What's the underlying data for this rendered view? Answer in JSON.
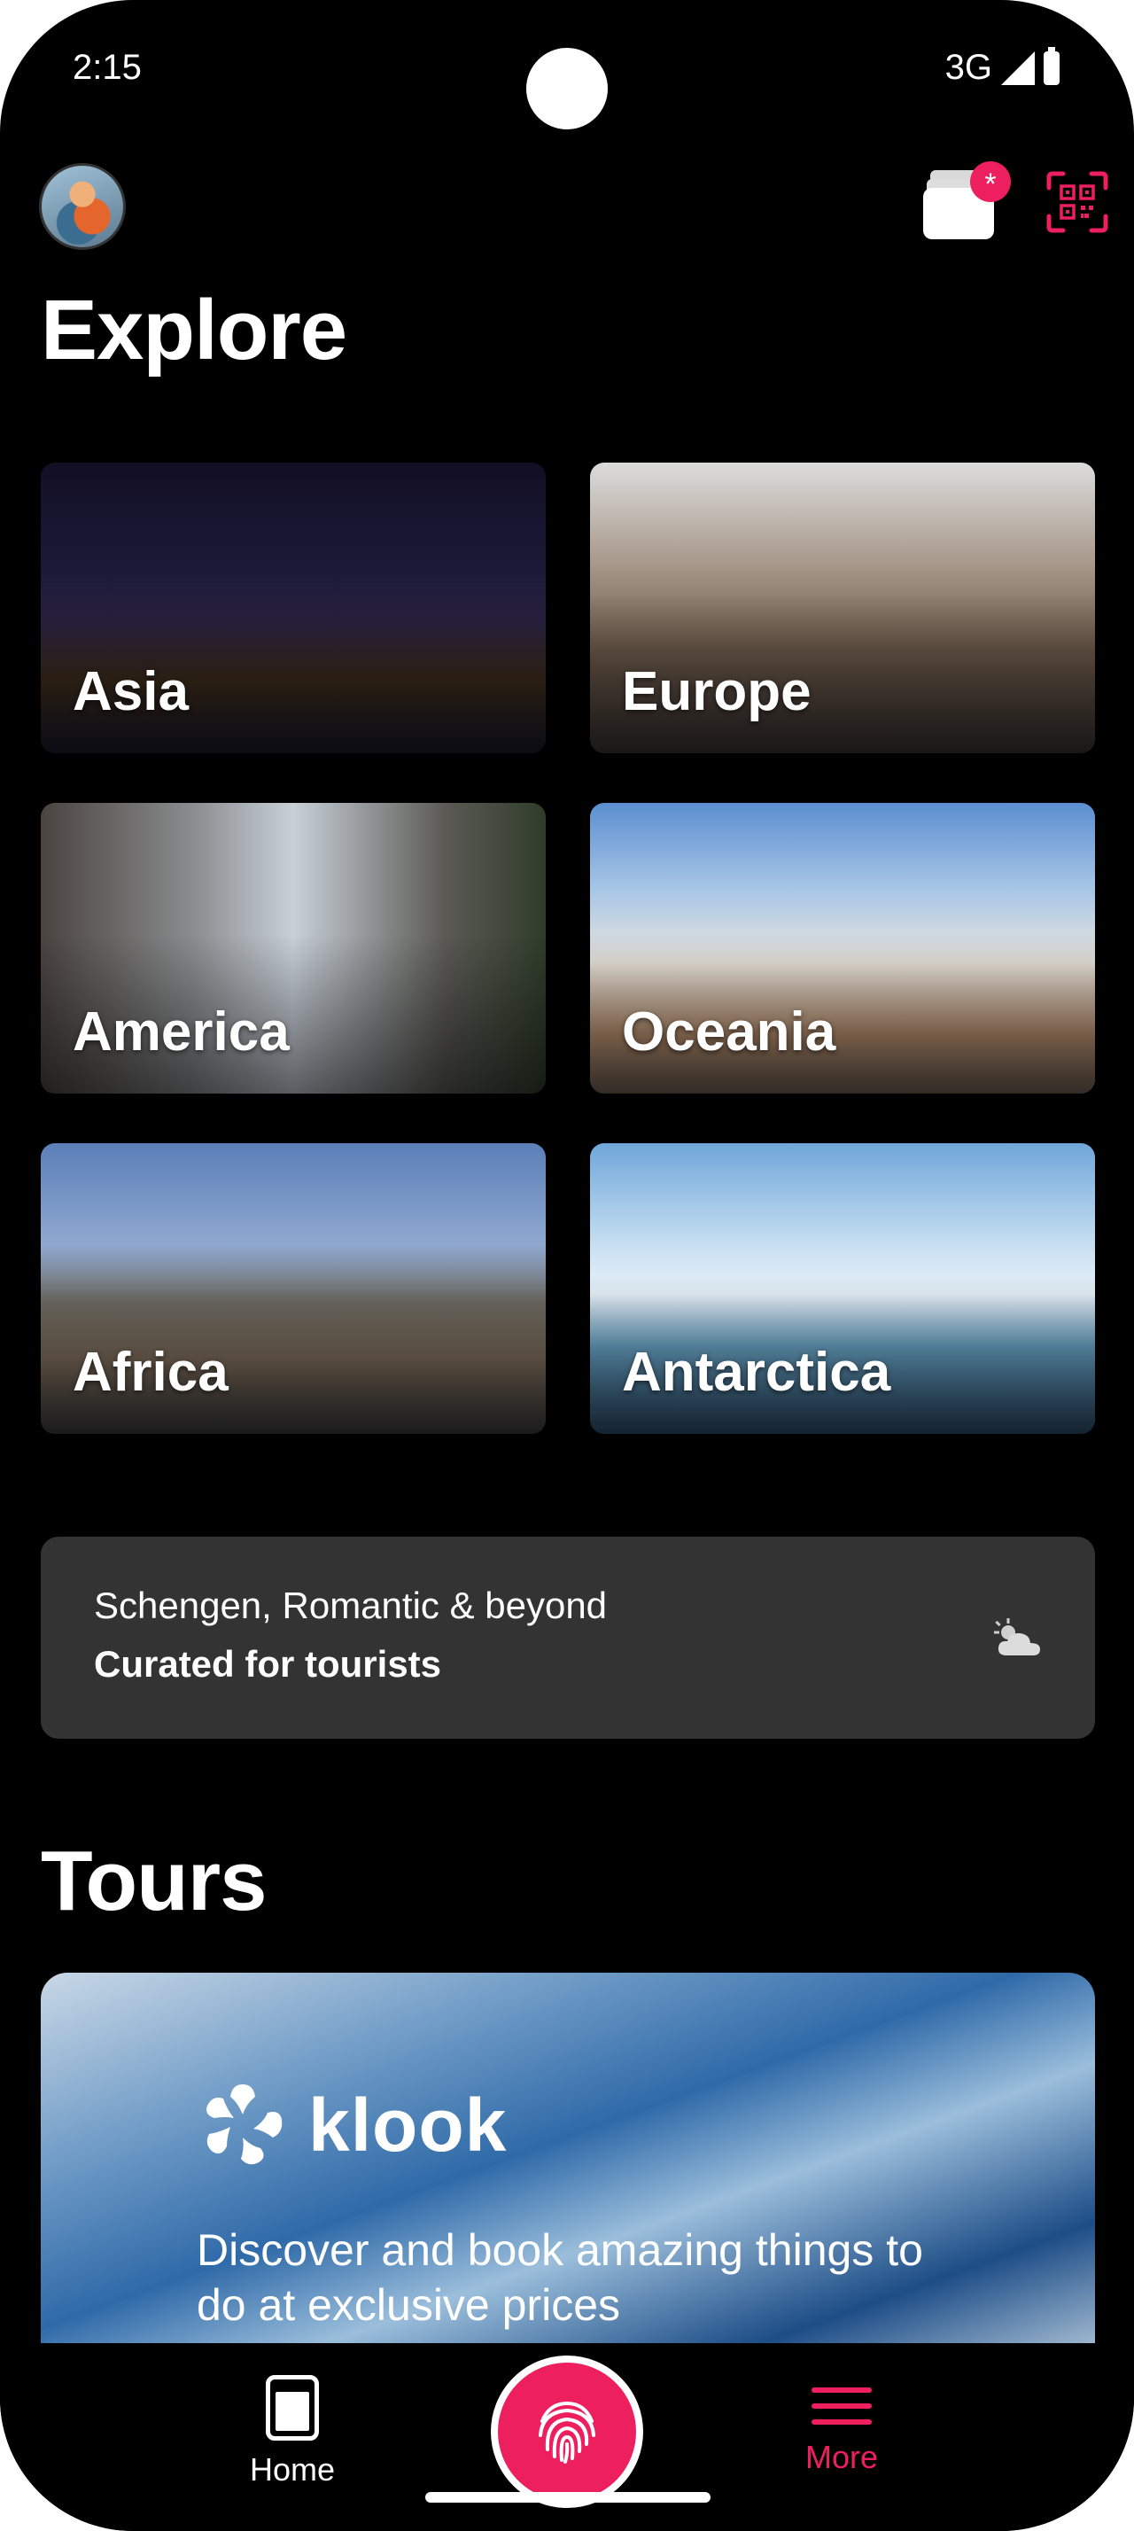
{
  "status_bar": {
    "time": "2:15",
    "network": "3G"
  },
  "header": {
    "avatar_icon": "avatar-photo",
    "wallet_icon": "wallet-icon",
    "wallet_badge": "*",
    "qr_icon": "qr-scan-icon",
    "accent_color": "#ee1f5f"
  },
  "explore": {
    "title": "Explore",
    "regions": [
      {
        "label": "Asia"
      },
      {
        "label": "Europe"
      },
      {
        "label": "America"
      },
      {
        "label": "Oceania"
      },
      {
        "label": "Africa"
      },
      {
        "label": "Antarctica"
      }
    ]
  },
  "promo": {
    "line1": "Schengen, Romantic & beyond",
    "line2": "Curated for tourists",
    "icon": "cloud-sun-icon"
  },
  "tours": {
    "title": "Tours",
    "banner": {
      "brand": "klook",
      "description": "Discover and book amazing things to do at exclusive prices"
    }
  },
  "bottom_nav": {
    "home_label": "Home",
    "more_label": "More",
    "fab_icon": "fingerprint-icon"
  }
}
